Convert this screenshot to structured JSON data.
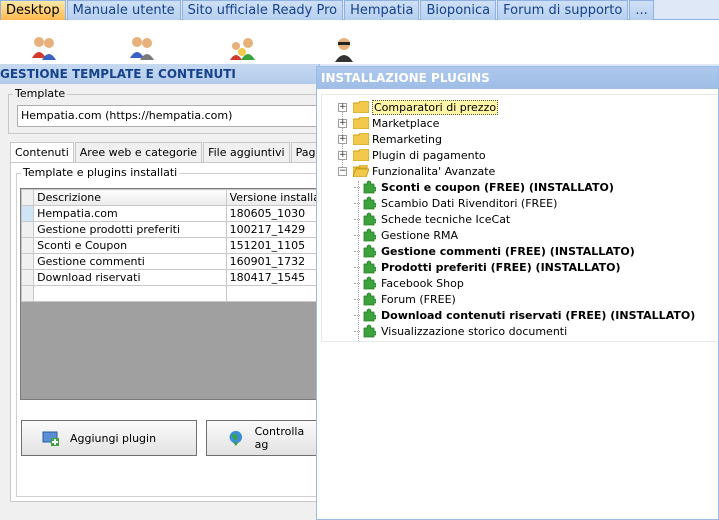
{
  "top_tabs": [
    "Desktop",
    "Manuale utente",
    "Sito ufficiale Ready Pro",
    "Hempatia",
    "Bioponica",
    "Forum di supporto",
    "..."
  ],
  "left_window": {
    "title": "GESTIONE TEMPLATE E CONTENUTI",
    "template_group_label": "Template",
    "template_value": "Hempatia.com (https://hempatia.com)",
    "sub_tabs": [
      "Contenuti",
      "Aree web e categorie",
      "File aggiuntivi",
      "Pagine di"
    ],
    "plugins_group_label": "Template e plugins installati",
    "columns": [
      "Descrizione",
      "Versione installa"
    ],
    "rows": [
      {
        "desc": "Hempatia.com",
        "ver": "180605_1030"
      },
      {
        "desc": "Gestione prodotti preferiti",
        "ver": "100217_1429"
      },
      {
        "desc": "Sconti e Coupon",
        "ver": "151201_1105"
      },
      {
        "desc": "Gestione commenti",
        "ver": "160901_1732"
      },
      {
        "desc": "Download riservati",
        "ver": "180417_1545"
      }
    ],
    "add_plugin_label": "Aggiungi plugin",
    "check_label": "Controlla ag"
  },
  "right_window": {
    "title": "INSTALLAZIONE PLUGINS",
    "categories": [
      "Comparatori di prezzo",
      "Marketplace",
      "Remarketing",
      "Plugin di pagamento",
      "Funzionalita' Avanzate"
    ],
    "plugins": [
      {
        "label": "Sconti e coupon (FREE) (INSTALLATO)",
        "installed": true
      },
      {
        "label": "Scambio Dati Rivenditori (FREE)",
        "installed": false
      },
      {
        "label": "Schede tecniche IceCat",
        "installed": false
      },
      {
        "label": "Gestione RMA",
        "installed": false
      },
      {
        "label": "Gestione commenti (FREE) (INSTALLATO)",
        "installed": true
      },
      {
        "label": "Prodotti preferiti (FREE) (INSTALLATO)",
        "installed": true
      },
      {
        "label": "Facebook Shop",
        "installed": false
      },
      {
        "label": "Forum (FREE)",
        "installed": false
      },
      {
        "label": "Download contenuti riservati (FREE) (INSTALLATO)",
        "installed": true
      },
      {
        "label": "Visualizzazione storico documenti",
        "installed": false
      }
    ]
  },
  "colors": {
    "active_tab": "#ffb84d",
    "header_blue": "#15428b",
    "plugin_green": "#3ca33c",
    "folder_yellow": "#f2c94c"
  }
}
